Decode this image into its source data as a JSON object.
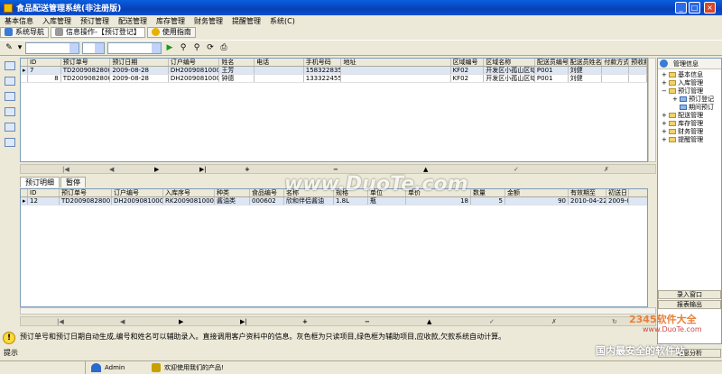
{
  "window": {
    "title": "食品配送管理系统(非注册版)",
    "btn_min": "_",
    "btn_max": "□",
    "btn_close": "×"
  },
  "menu": [
    "基本信息",
    "入库管理",
    "预订管理",
    "配送管理",
    "库存管理",
    "财务管理",
    "提醒管理",
    "系统(C)"
  ],
  "nav": {
    "system_nav": "系统导航",
    "current_tab": "信息操作-【预订登记】",
    "guide": "使用指南"
  },
  "top_grid": {
    "columns": [
      "ID",
      "预订单号",
      "预订日期",
      "订户编号",
      "姓名",
      "电话",
      "手机号码",
      "地址",
      "区域编号",
      "区域名称",
      "配送员编号",
      "配送员姓名",
      "付款方式",
      "预收款"
    ],
    "rows": [
      [
        "7",
        "TD20090828001",
        "2009-08-28",
        "DH20090810001",
        "王芳",
        "",
        "15832283568",
        "",
        "KF02",
        "开发区小孤山区域",
        "P001",
        "刘健",
        "",
        ""
      ],
      [
        "8",
        "TD20090828002",
        "2009-08-28",
        "DH20090810002",
        "钟德",
        "",
        "13332245576",
        "",
        "KF02",
        "开发区小孤山区域",
        "P001",
        "刘健",
        "",
        ""
      ]
    ]
  },
  "nav_symbols": {
    "first": "|◀",
    "prev": "◀",
    "next": "▶",
    "last": "▶|",
    "add": "+",
    "delete": "−",
    "up": "▲",
    "ok": "✓",
    "cancel": "✗",
    "refresh": "↻"
  },
  "detail_tabs": [
    "预订明细",
    "暂停"
  ],
  "bottom_grid": {
    "columns": [
      "ID",
      "预订单号",
      "订户编号",
      "入库序号",
      "种类",
      "食品编号",
      "名称",
      "规格",
      "单位",
      "单价",
      "数量",
      "金额",
      "有效期至",
      "初送日"
    ],
    "rows": [
      [
        "12",
        "TD20090828001",
        "DH20090810001",
        "RK20090810001",
        "酱油类",
        "000602",
        "欣和伴侣酱油",
        "1.8L",
        "瓶",
        "18",
        "5",
        "90",
        "2010-04-22",
        "2009-0"
      ]
    ]
  },
  "right_panel": {
    "header": "管理信息",
    "tree": [
      "基本信息",
      "入库管理",
      "预订管理",
      "预订登记",
      "期间预订",
      "配送管理",
      "库存管理",
      "财务管理",
      "提醒管理"
    ],
    "btn_entry": "录入窗口",
    "btn_report": "报表输出",
    "btn_analysis": "信息分析"
  },
  "hint": {
    "text": "预订单号和预订日期自动生成,编号和姓名可以辅助录入。直接调用客户资料中的信息。灰色框为只读项目,绿色框为辅助项目,应收款,欠款系统自动计算。",
    "label": "提示"
  },
  "status": {
    "user": "Admin",
    "welcome": "欢迎使用我们的产品!"
  },
  "watermarks": {
    "duote": "www.DuoTe.com",
    "site2345": "2345软件大全",
    "duote_url": "www.DuoTe.com",
    "slogan": "国内最安全的软件站"
  }
}
